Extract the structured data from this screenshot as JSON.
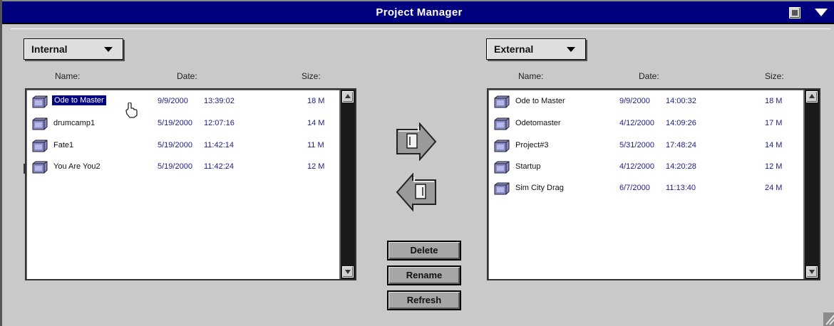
{
  "window": {
    "title": "Project Manager"
  },
  "left": {
    "location": "Internal",
    "columns": {
      "name": "Name:",
      "date": "Date:",
      "size": "Size:"
    },
    "rows": [
      {
        "name": "Ode to Master",
        "date": "9/9/2000",
        "time": "13:39:02",
        "size": "18 M",
        "selected": true
      },
      {
        "name": "drumcamp1",
        "date": "5/19/2000",
        "time": "12:07:16",
        "size": "14 M"
      },
      {
        "name": "Fate1",
        "date": "5/19/2000",
        "time": "11:42:14",
        "size": "11 M"
      },
      {
        "name": "You Are You2",
        "date": "5/19/2000",
        "time": "11:42:24",
        "size": "12 M"
      }
    ]
  },
  "right": {
    "location": "External",
    "columns": {
      "name": "Name:",
      "date": "Date:",
      "size": "Size:"
    },
    "rows": [
      {
        "name": "Ode to Master",
        "date": "9/9/2000",
        "time": "14:00:32",
        "size": "18 M"
      },
      {
        "name": "Odetomaster",
        "date": "4/12/2000",
        "time": "14:09:26",
        "size": "17 M"
      },
      {
        "name": "Project#3",
        "date": "5/31/2000",
        "time": "17:48:24",
        "size": "14 M"
      },
      {
        "name": "Startup",
        "date": "4/12/2000",
        "time": "14:20:28",
        "size": "12 M"
      },
      {
        "name": "Sim City Drag",
        "date": "6/7/2000",
        "time": "11:13:40",
        "size": "24 M"
      }
    ]
  },
  "buttons": {
    "delete": "Delete",
    "rename": "Rename",
    "refresh": "Refresh"
  },
  "icons": {
    "project": "folder-icon",
    "copy_to_external": "arrow-right-icon",
    "copy_to_internal": "arrow-left-icon",
    "close": "close-icon",
    "window_menu": "chevron-down-icon",
    "resize": "resize-grip-icon",
    "cursor": "mouse-cursor-icon"
  },
  "colors": {
    "titlebar": "#00007e",
    "selection": "#00007e",
    "date_text": "#1c1c8a",
    "window_bg": "#c9c9c9"
  }
}
